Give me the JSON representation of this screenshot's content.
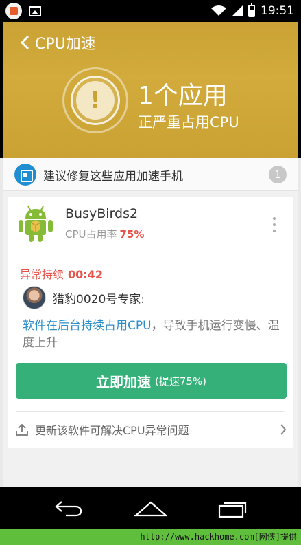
{
  "status_bar": {
    "time": "19:51",
    "icons": [
      "app-notification-icon",
      "image-icon",
      "wifi-icon",
      "signal-icon",
      "battery-icon"
    ]
  },
  "header": {
    "back_label": "CPU加速",
    "title": "1个应用",
    "subtitle": "正严重占用CPU",
    "background_color": "#caa235",
    "alert_icon": "exclamation-icon"
  },
  "suggestion": {
    "text": "建议修复这些应用加速手机",
    "count": "1",
    "icon": "cpu-chip-icon",
    "icon_color": "#1f8fd1"
  },
  "app": {
    "name": "BusyBirds2",
    "usage_label": "CPU占用率",
    "usage_value": "75%",
    "icon": "android-robot-icon",
    "more_icon": "more-vertical-icon"
  },
  "diagnosis": {
    "abnormal_label": "异常持续",
    "abnormal_time": "00:42",
    "expert_name": "猎豹0020号专家:",
    "advice_highlight": "软件在后台持续占用CPU",
    "advice_rest": "，导致手机运行变慢、温度上升"
  },
  "boost_button": {
    "label": "立即加速",
    "sub_label": "(提速75%)",
    "color": "#36b079"
  },
  "update_row": {
    "text": "更新该软件可解决CPU异常问题",
    "icon": "upload-icon",
    "chevron": "chevron-right-icon"
  },
  "nav_bar": {
    "icons": [
      "back-nav-icon",
      "home-nav-icon",
      "recent-apps-icon"
    ]
  },
  "watermark": {
    "text": "http://www.hackhome.com[网侠]提供"
  }
}
